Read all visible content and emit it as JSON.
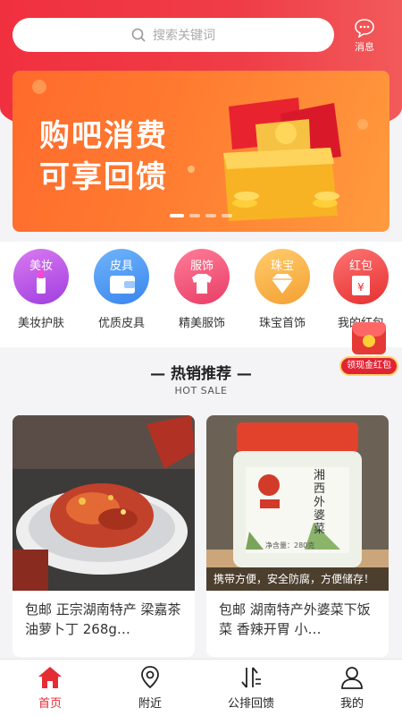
{
  "search": {
    "placeholder": "搜索关键词"
  },
  "header": {
    "message_label": "消息"
  },
  "banner": {
    "line1": "购吧消费",
    "line2": "可享回馈"
  },
  "categories": [
    {
      "tag": "美妆",
      "label": "美妆护肤",
      "color": "#c255e8"
    },
    {
      "tag": "皮具",
      "label": "优质皮具",
      "color": "#4f9bf2"
    },
    {
      "tag": "服饰",
      "label": "精美服饰",
      "color": "#f05a7c"
    },
    {
      "tag": "珠宝",
      "label": "珠宝首饰",
      "color": "#f7b44a"
    },
    {
      "tag": "红包",
      "label": "我的红包",
      "color": "#ef4c4c"
    }
  ],
  "floating": {
    "label": "领现金红包"
  },
  "section": {
    "title": "— 热销推荐 —",
    "subtitle": "HOT SALE"
  },
  "products": [
    {
      "title": "包邮 正宗湖南特产 梁嘉茶油萝卜丁 268g…"
    },
    {
      "title": "包邮 湖南特产外婆菜下饭菜 香辣开胃 小…",
      "caption": "携带方便，安全防腐，方便储存！",
      "jar_text": "湘西外婆菜",
      "net_weight": "净含量：280克"
    }
  ],
  "tabbar": [
    {
      "label": "首页"
    },
    {
      "label": "附近"
    },
    {
      "label": "公排回馈"
    },
    {
      "label": "我的"
    }
  ],
  "colors": {
    "brand_red": "#ef3340",
    "active_tab": "#e52c35"
  }
}
